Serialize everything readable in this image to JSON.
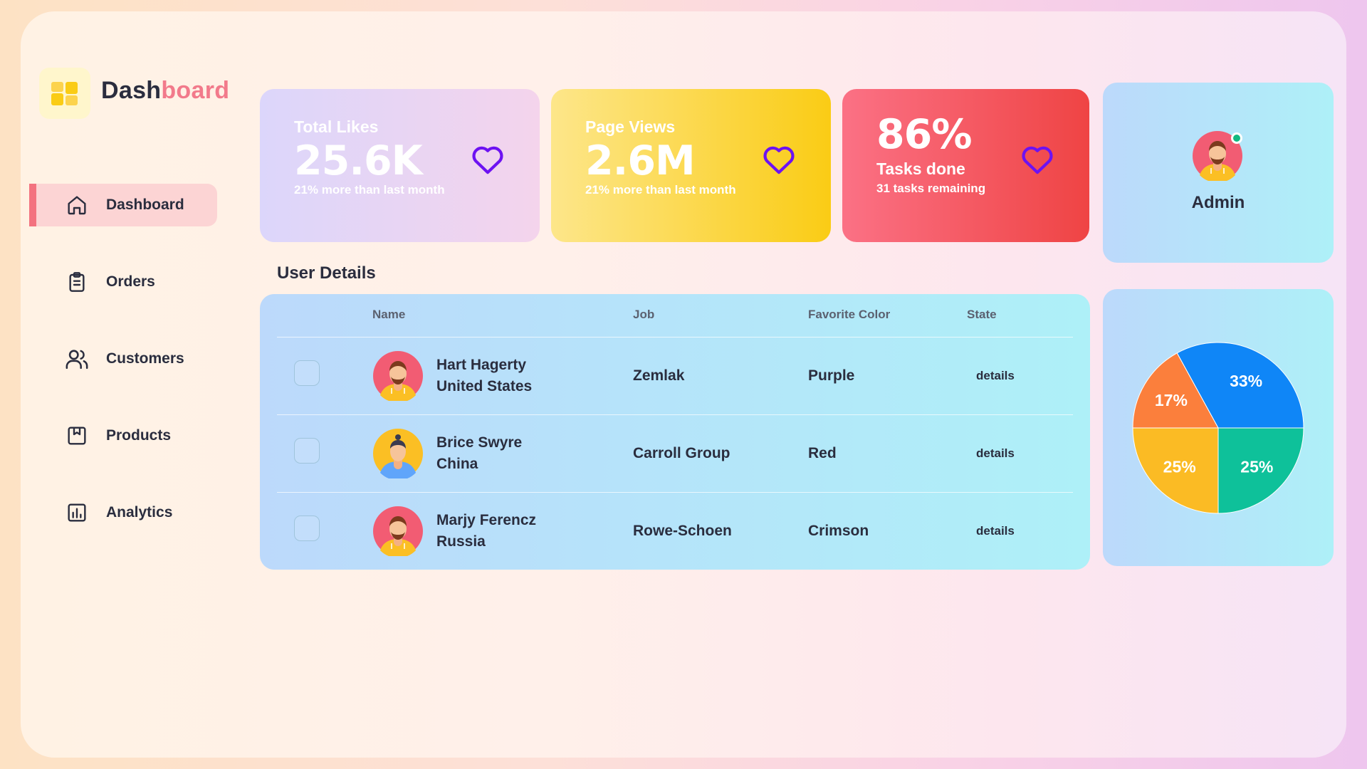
{
  "brand": {
    "title_dark": "Dash",
    "title_accent": "board"
  },
  "sidebar": {
    "items": [
      {
        "label": "Dashboard",
        "icon": "home-icon",
        "active": true
      },
      {
        "label": "Orders",
        "icon": "clipboard-icon",
        "active": false
      },
      {
        "label": "Customers",
        "icon": "users-icon",
        "active": false
      },
      {
        "label": "Products",
        "icon": "bookmark-box-icon",
        "active": false
      },
      {
        "label": "Analytics",
        "icon": "bar-chart-icon",
        "active": false
      }
    ]
  },
  "cards": [
    {
      "label": "Total Likes",
      "value": "25.6K",
      "sub": "21% more than last month",
      "icon": "heart-icon"
    },
    {
      "label": "Page Views",
      "value": "2.6M",
      "sub": "21% more than last month",
      "icon": "heart-icon"
    },
    {
      "value": "86%",
      "label": "Tasks done",
      "sub": "31 tasks remaining",
      "icon": "heart-icon"
    }
  ],
  "profile": {
    "name": "Admin",
    "status": "online"
  },
  "user_details": {
    "title": "User Details",
    "columns": [
      "Name",
      "Job",
      "Favorite Color",
      "State"
    ],
    "rows": [
      {
        "name": "Hart Hagerty",
        "country": "United States",
        "job": "Zemlak",
        "color": "Purple",
        "action": "details",
        "checked": false
      },
      {
        "name": "Brice Swyre",
        "country": "China",
        "job": "Carroll Group",
        "color": "Red",
        "action": "details",
        "checked": false
      },
      {
        "name": "Marjy Ferencz",
        "country": "Russia",
        "job": "Rowe-Schoen",
        "color": "Crimson",
        "action": "details",
        "checked": false
      }
    ]
  },
  "chart_data": {
    "type": "pie",
    "slices": [
      {
        "label": "33%",
        "value": 33,
        "color": "#0f86f7"
      },
      {
        "label": "17%",
        "value": 17,
        "color": "#fb7f3c"
      },
      {
        "label": "25%",
        "value": 25,
        "color": "#fbbb24"
      },
      {
        "label": "25%",
        "value": 25,
        "color": "#0ec19a"
      }
    ]
  },
  "colors": {
    "accent": "#f27a8b",
    "heart": "#6d12f2",
    "text": "#2a2d3e"
  }
}
